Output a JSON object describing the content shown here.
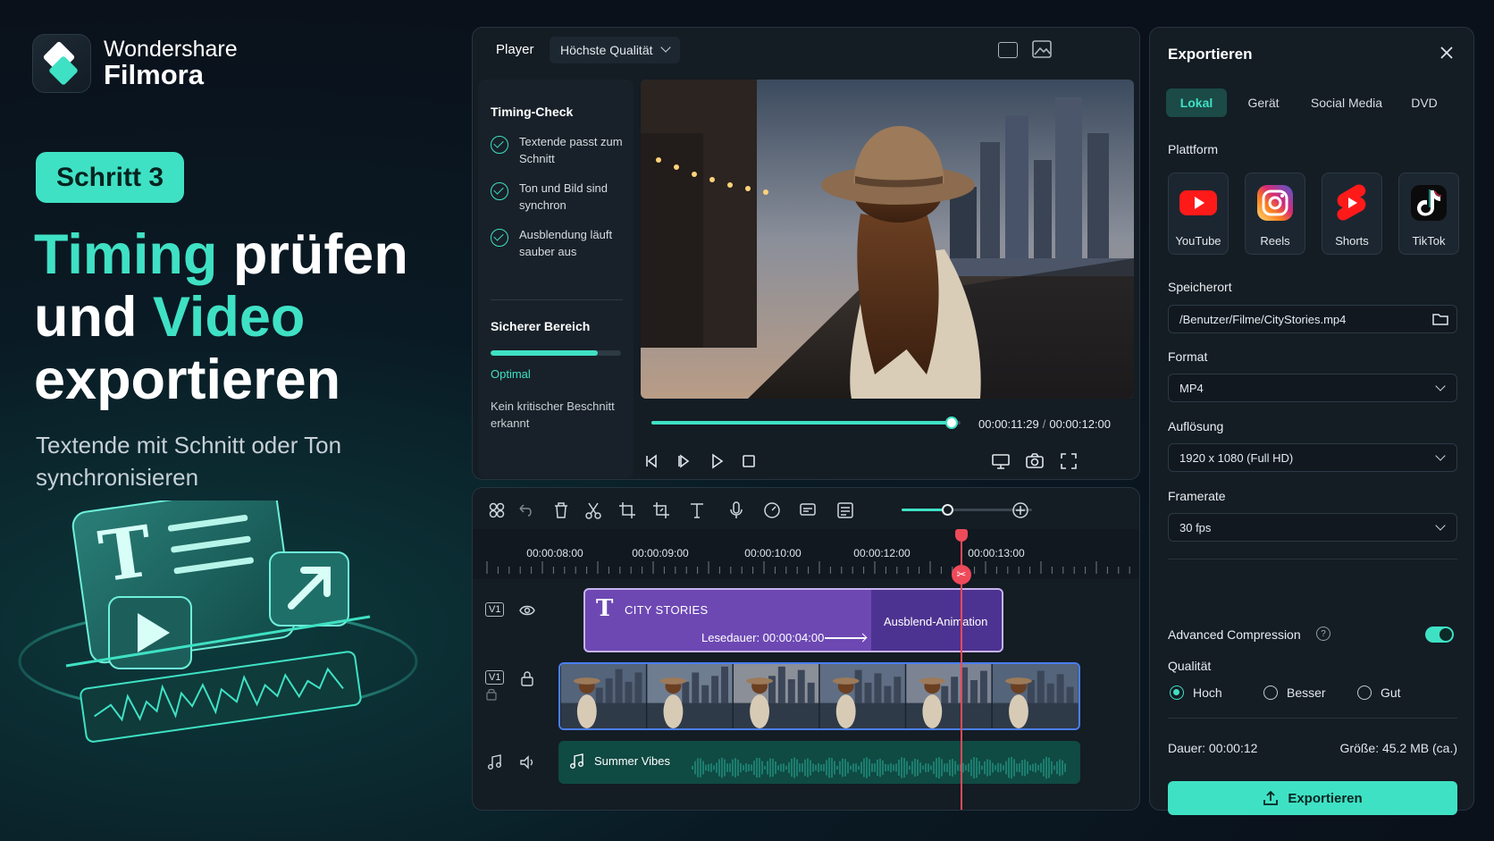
{
  "brand": {
    "line1": "Wondershare",
    "line2": "Filmora"
  },
  "promo": {
    "step": "Schritt 3",
    "headline": [
      [
        {
          "text": "Timing",
          "accent": true
        },
        {
          "text": " prüfen",
          "accent": false
        }
      ],
      [
        {
          "text": "und ",
          "accent": false
        },
        {
          "text": "Video",
          "accent": true
        }
      ],
      [
        {
          "text": "exportieren",
          "accent": false
        }
      ]
    ],
    "subline": "Textende mit Schnitt oder Ton synchronisieren"
  },
  "player": {
    "title": "Player",
    "quality": "Höchste Qualität",
    "current_time": "00:00:11:29",
    "total_time": "00:00:12:00",
    "progress": 0.97,
    "timing_check": {
      "title": "Timing-Check",
      "items": [
        "Textende passt zum Schnitt",
        "Ton und Bild sind synchron",
        "Ausblendung läuft sauber aus"
      ]
    },
    "safe_area": {
      "title": "Sicherer Bereich",
      "level": 0.82,
      "status": "Optimal",
      "note": "Kein kritischer Beschnitt erkannt"
    }
  },
  "timeline": {
    "zoom": 0.35,
    "ruler": [
      "00:00:08:00",
      "00:00:09:00",
      "00:00:10:00",
      "00:00:12:00",
      "00:00:13:00"
    ],
    "text_clip": {
      "name": "CITY STORIES",
      "read_time": "Lesedauer: 00:00:04:00",
      "animation": "Ausblend-Animation"
    },
    "video_track_label": "V1",
    "text_track_label": "V1",
    "audio_clip": {
      "name": "Summer Vibes"
    }
  },
  "export": {
    "title": "Exportieren",
    "tabs": [
      "Lokal",
      "Gerät",
      "Social Media",
      "DVD"
    ],
    "active_tab": 0,
    "platform_label": "Plattform",
    "platforms": [
      {
        "name": "YouTube",
        "icon": "youtube-icon"
      },
      {
        "name": "Reels",
        "icon": "instagram-icon"
      },
      {
        "name": "Shorts",
        "icon": "shorts-icon"
      },
      {
        "name": "TikTok",
        "icon": "tiktok-icon"
      }
    ],
    "location_label": "Speicherort",
    "location": "/Benutzer/Filme/CityStories.mp4",
    "format_label": "Format",
    "format": "MP4",
    "resolution_label": "Auflösung",
    "resolution": "1920 x 1080 (Full HD)",
    "framerate_label": "Framerate",
    "framerate": "30 fps",
    "compression_label": "Advanced Compression",
    "compression_on": true,
    "quality_label": "Qualität",
    "quality_options": [
      "Hoch",
      "Besser",
      "Gut"
    ],
    "quality_selected": 0,
    "duration": "Dauer: 00:00:12",
    "size": "Größe: 45.2 MB (ca.)",
    "button": "Exportieren"
  },
  "colors": {
    "accent": "#3fe1c4",
    "playhead": "#ef4a5a",
    "text_clip": "#6d48b3"
  }
}
